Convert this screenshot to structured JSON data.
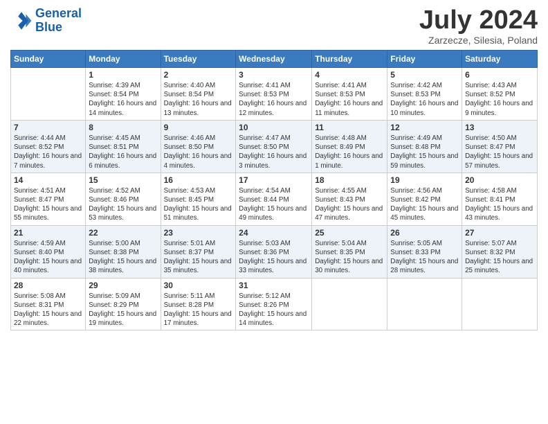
{
  "logo": {
    "line1": "General",
    "line2": "Blue"
  },
  "header": {
    "title": "July 2024",
    "subtitle": "Zarzecze, Silesia, Poland"
  },
  "columns": [
    "Sunday",
    "Monday",
    "Tuesday",
    "Wednesday",
    "Thursday",
    "Friday",
    "Saturday"
  ],
  "weeks": [
    [
      {
        "day": "",
        "sunrise": "",
        "sunset": "",
        "daylight": ""
      },
      {
        "day": "1",
        "sunrise": "Sunrise: 4:39 AM",
        "sunset": "Sunset: 8:54 PM",
        "daylight": "Daylight: 16 hours and 14 minutes."
      },
      {
        "day": "2",
        "sunrise": "Sunrise: 4:40 AM",
        "sunset": "Sunset: 8:54 PM",
        "daylight": "Daylight: 16 hours and 13 minutes."
      },
      {
        "day": "3",
        "sunrise": "Sunrise: 4:41 AM",
        "sunset": "Sunset: 8:53 PM",
        "daylight": "Daylight: 16 hours and 12 minutes."
      },
      {
        "day": "4",
        "sunrise": "Sunrise: 4:41 AM",
        "sunset": "Sunset: 8:53 PM",
        "daylight": "Daylight: 16 hours and 11 minutes."
      },
      {
        "day": "5",
        "sunrise": "Sunrise: 4:42 AM",
        "sunset": "Sunset: 8:53 PM",
        "daylight": "Daylight: 16 hours and 10 minutes."
      },
      {
        "day": "6",
        "sunrise": "Sunrise: 4:43 AM",
        "sunset": "Sunset: 8:52 PM",
        "daylight": "Daylight: 16 hours and 9 minutes."
      }
    ],
    [
      {
        "day": "7",
        "sunrise": "Sunrise: 4:44 AM",
        "sunset": "Sunset: 8:52 PM",
        "daylight": "Daylight: 16 hours and 7 minutes."
      },
      {
        "day": "8",
        "sunrise": "Sunrise: 4:45 AM",
        "sunset": "Sunset: 8:51 PM",
        "daylight": "Daylight: 16 hours and 6 minutes."
      },
      {
        "day": "9",
        "sunrise": "Sunrise: 4:46 AM",
        "sunset": "Sunset: 8:50 PM",
        "daylight": "Daylight: 16 hours and 4 minutes."
      },
      {
        "day": "10",
        "sunrise": "Sunrise: 4:47 AM",
        "sunset": "Sunset: 8:50 PM",
        "daylight": "Daylight: 16 hours and 3 minutes."
      },
      {
        "day": "11",
        "sunrise": "Sunrise: 4:48 AM",
        "sunset": "Sunset: 8:49 PM",
        "daylight": "Daylight: 16 hours and 1 minute."
      },
      {
        "day": "12",
        "sunrise": "Sunrise: 4:49 AM",
        "sunset": "Sunset: 8:48 PM",
        "daylight": "Daylight: 15 hours and 59 minutes."
      },
      {
        "day": "13",
        "sunrise": "Sunrise: 4:50 AM",
        "sunset": "Sunset: 8:47 PM",
        "daylight": "Daylight: 15 hours and 57 minutes."
      }
    ],
    [
      {
        "day": "14",
        "sunrise": "Sunrise: 4:51 AM",
        "sunset": "Sunset: 8:47 PM",
        "daylight": "Daylight: 15 hours and 55 minutes."
      },
      {
        "day": "15",
        "sunrise": "Sunrise: 4:52 AM",
        "sunset": "Sunset: 8:46 PM",
        "daylight": "Daylight: 15 hours and 53 minutes."
      },
      {
        "day": "16",
        "sunrise": "Sunrise: 4:53 AM",
        "sunset": "Sunset: 8:45 PM",
        "daylight": "Daylight: 15 hours and 51 minutes."
      },
      {
        "day": "17",
        "sunrise": "Sunrise: 4:54 AM",
        "sunset": "Sunset: 8:44 PM",
        "daylight": "Daylight: 15 hours and 49 minutes."
      },
      {
        "day": "18",
        "sunrise": "Sunrise: 4:55 AM",
        "sunset": "Sunset: 8:43 PM",
        "daylight": "Daylight: 15 hours and 47 minutes."
      },
      {
        "day": "19",
        "sunrise": "Sunrise: 4:56 AM",
        "sunset": "Sunset: 8:42 PM",
        "daylight": "Daylight: 15 hours and 45 minutes."
      },
      {
        "day": "20",
        "sunrise": "Sunrise: 4:58 AM",
        "sunset": "Sunset: 8:41 PM",
        "daylight": "Daylight: 15 hours and 43 minutes."
      }
    ],
    [
      {
        "day": "21",
        "sunrise": "Sunrise: 4:59 AM",
        "sunset": "Sunset: 8:40 PM",
        "daylight": "Daylight: 15 hours and 40 minutes."
      },
      {
        "day": "22",
        "sunrise": "Sunrise: 5:00 AM",
        "sunset": "Sunset: 8:38 PM",
        "daylight": "Daylight: 15 hours and 38 minutes."
      },
      {
        "day": "23",
        "sunrise": "Sunrise: 5:01 AM",
        "sunset": "Sunset: 8:37 PM",
        "daylight": "Daylight: 15 hours and 35 minutes."
      },
      {
        "day": "24",
        "sunrise": "Sunrise: 5:03 AM",
        "sunset": "Sunset: 8:36 PM",
        "daylight": "Daylight: 15 hours and 33 minutes."
      },
      {
        "day": "25",
        "sunrise": "Sunrise: 5:04 AM",
        "sunset": "Sunset: 8:35 PM",
        "daylight": "Daylight: 15 hours and 30 minutes."
      },
      {
        "day": "26",
        "sunrise": "Sunrise: 5:05 AM",
        "sunset": "Sunset: 8:33 PM",
        "daylight": "Daylight: 15 hours and 28 minutes."
      },
      {
        "day": "27",
        "sunrise": "Sunrise: 5:07 AM",
        "sunset": "Sunset: 8:32 PM",
        "daylight": "Daylight: 15 hours and 25 minutes."
      }
    ],
    [
      {
        "day": "28",
        "sunrise": "Sunrise: 5:08 AM",
        "sunset": "Sunset: 8:31 PM",
        "daylight": "Daylight: 15 hours and 22 minutes."
      },
      {
        "day": "29",
        "sunrise": "Sunrise: 5:09 AM",
        "sunset": "Sunset: 8:29 PM",
        "daylight": "Daylight: 15 hours and 19 minutes."
      },
      {
        "day": "30",
        "sunrise": "Sunrise: 5:11 AM",
        "sunset": "Sunset: 8:28 PM",
        "daylight": "Daylight: 15 hours and 17 minutes."
      },
      {
        "day": "31",
        "sunrise": "Sunrise: 5:12 AM",
        "sunset": "Sunset: 8:26 PM",
        "daylight": "Daylight: 15 hours and 14 minutes."
      },
      {
        "day": "",
        "sunrise": "",
        "sunset": "",
        "daylight": ""
      },
      {
        "day": "",
        "sunrise": "",
        "sunset": "",
        "daylight": ""
      },
      {
        "day": "",
        "sunrise": "",
        "sunset": "",
        "daylight": ""
      }
    ]
  ]
}
